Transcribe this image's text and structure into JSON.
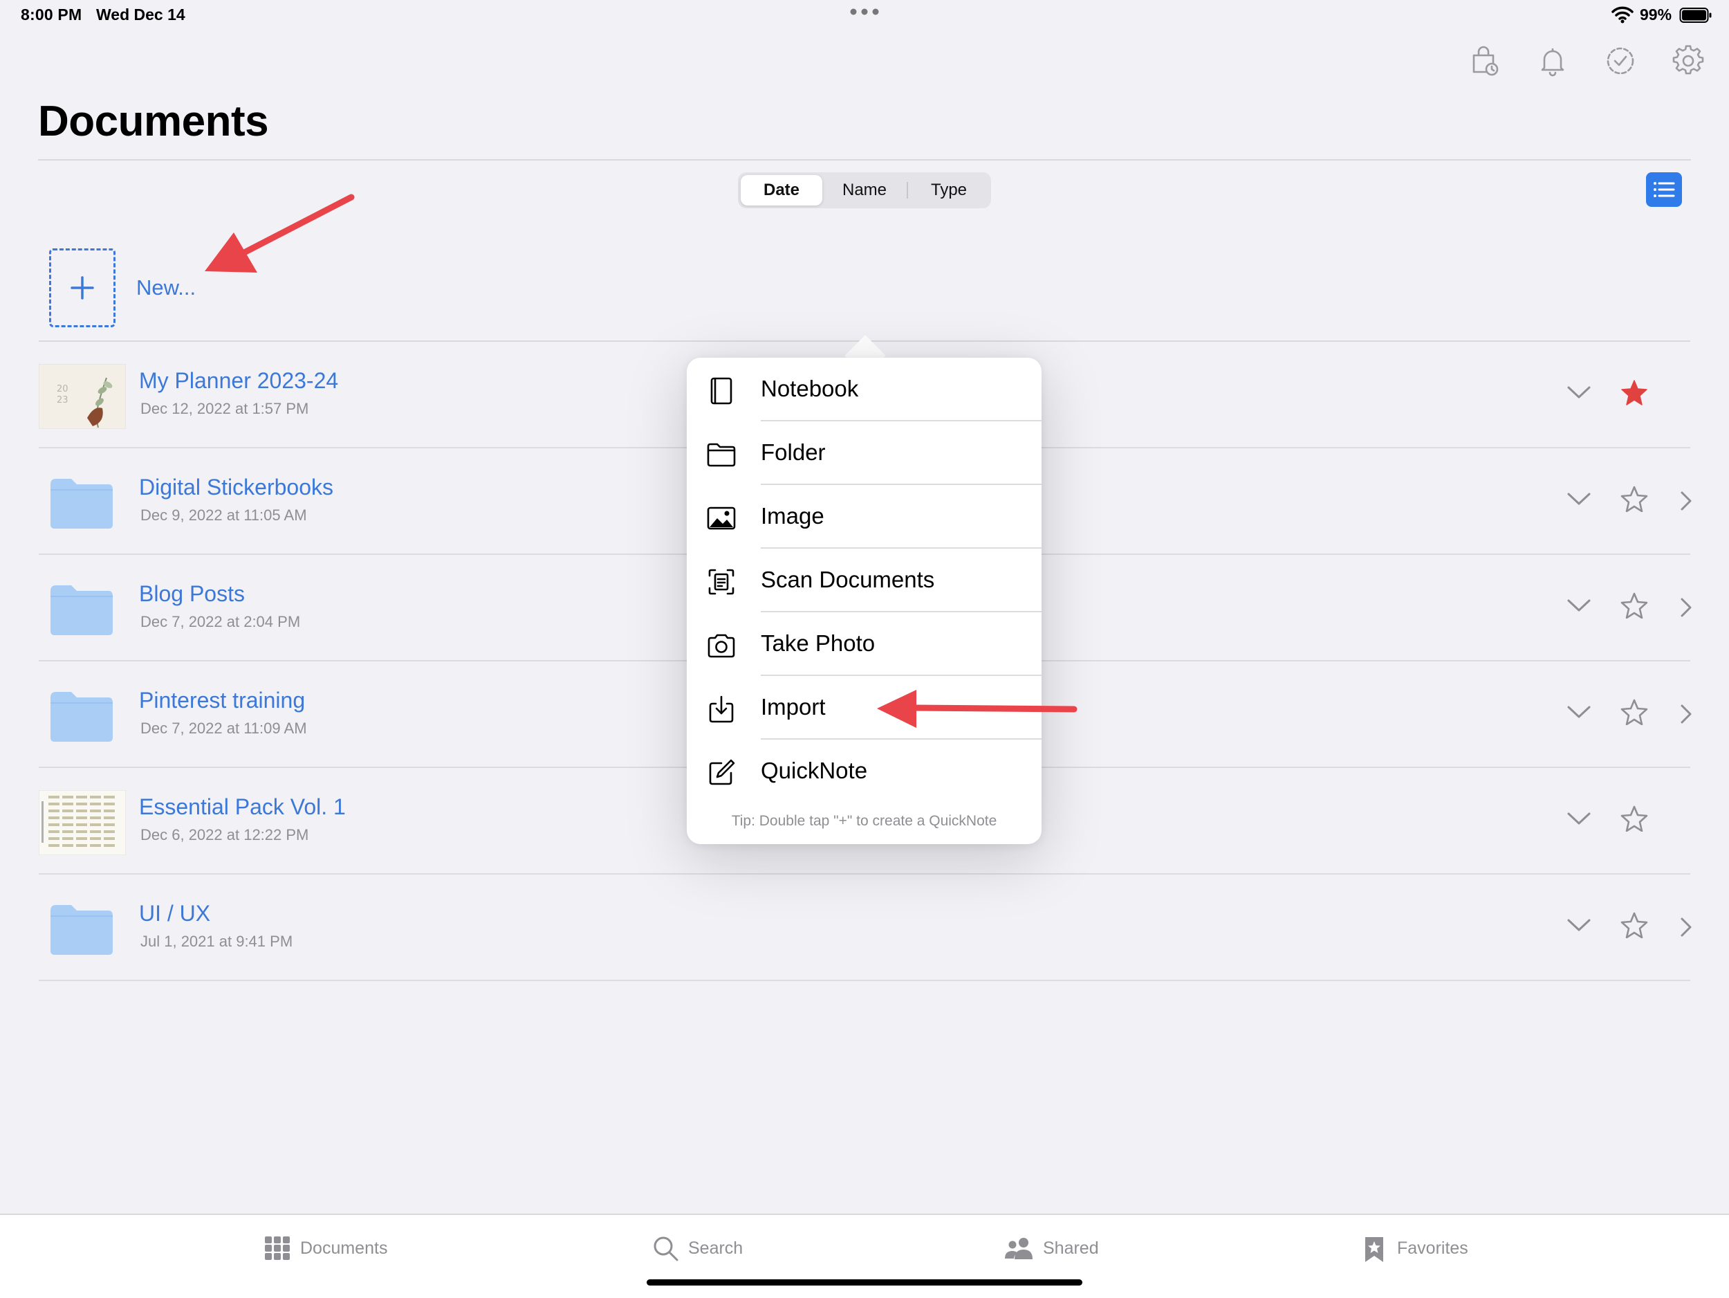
{
  "status_bar": {
    "time": "8:00 PM",
    "date": "Wed Dec 14",
    "battery": "99%"
  },
  "page": {
    "title": "Documents"
  },
  "sort": {
    "options": [
      "Date",
      "Name",
      "Type"
    ],
    "selected": "Date"
  },
  "new": {
    "label": "New..."
  },
  "documents": [
    {
      "name": "My Planner 2023-24",
      "date": "Dec 12, 2022 at 1:57 PM",
      "kind": "document",
      "favorite": true
    },
    {
      "name": "Digital Stickerbooks",
      "date": "Dec 9, 2022 at 11:05 AM",
      "kind": "folder",
      "favorite": false
    },
    {
      "name": "Blog Posts",
      "date": "Dec 7, 2022 at 2:04 PM",
      "kind": "folder",
      "favorite": false
    },
    {
      "name": "Pinterest training",
      "date": "Dec 7, 2022 at 11:09 AM",
      "kind": "folder",
      "favorite": false
    },
    {
      "name": "Essential Pack Vol. 1",
      "date": "Dec 6, 2022 at 12:22 PM",
      "kind": "document",
      "favorite": false
    },
    {
      "name": "UI / UX",
      "date": "Jul 1, 2021 at 9:41 PM",
      "kind": "folder",
      "favorite": false
    }
  ],
  "new_menu": {
    "items": [
      {
        "label": "Notebook",
        "icon": "notebook-icon"
      },
      {
        "label": "Folder",
        "icon": "folder-icon"
      },
      {
        "label": "Image",
        "icon": "image-icon"
      },
      {
        "label": "Scan Documents",
        "icon": "scan-icon"
      },
      {
        "label": "Take Photo",
        "icon": "camera-icon"
      },
      {
        "label": "Import",
        "icon": "import-icon"
      },
      {
        "label": "QuickNote",
        "icon": "quicknote-icon"
      }
    ],
    "tip": "Tip: Double tap \"+\" to create a QuickNote"
  },
  "tabbar": {
    "tabs": [
      {
        "label": "Documents",
        "icon": "grid-icon"
      },
      {
        "label": "Search",
        "icon": "search-icon"
      },
      {
        "label": "Shared",
        "icon": "people-icon"
      },
      {
        "label": "Favorites",
        "icon": "bookmark-star-icon"
      }
    ]
  },
  "colors": {
    "accent": "#3b78d8",
    "favorite_star": "#e0433f",
    "annotation_arrow": "#e8444a",
    "folder": "#a9cdf5"
  }
}
